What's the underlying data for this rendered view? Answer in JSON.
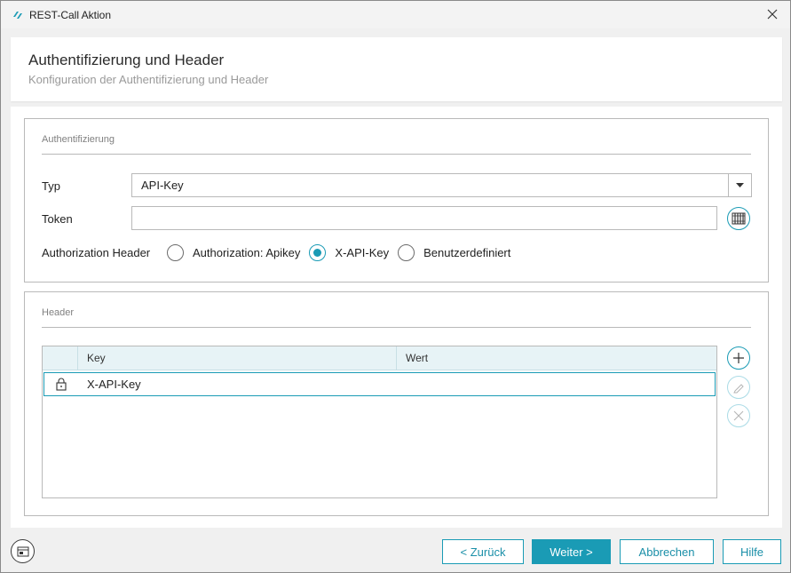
{
  "window": {
    "title": "REST-Call Aktion"
  },
  "header": {
    "title": "Authentifizierung und Header",
    "subtitle": "Konfiguration der Authentifizierung und Header"
  },
  "auth": {
    "legend": "Authentifizierung",
    "type_label": "Typ",
    "type_value": "API-Key",
    "token_label": "Token",
    "token_value": "",
    "auth_header_label": "Authorization Header",
    "options": [
      {
        "label": "Authorization: Apikey",
        "checked": false
      },
      {
        "label": "X-API-Key",
        "checked": true
      },
      {
        "label": "Benutzerdefiniert",
        "checked": false
      }
    ]
  },
  "headers": {
    "legend": "Header",
    "columns": [
      "Key",
      "Wert"
    ],
    "rows": [
      {
        "locked": true,
        "key": "X-API-Key",
        "value": ""
      }
    ]
  },
  "footer": {
    "back": "< Zurück",
    "next": "Weiter >",
    "cancel": "Abbrechen",
    "help": "Hilfe"
  },
  "colors": {
    "accent": "#1a9bb5",
    "accent_light": "#aadbe6",
    "table_header_bg": "#e7f3f6"
  },
  "icons": {
    "app": "app-logo-icon",
    "close": "close-icon",
    "dropdown": "chevron-down-icon",
    "token_picker": "variable-picker-icon",
    "lock": "lock-icon",
    "add": "plus-icon",
    "edit": "pencil-icon",
    "delete": "x-icon",
    "footer_left": "window-icon"
  }
}
